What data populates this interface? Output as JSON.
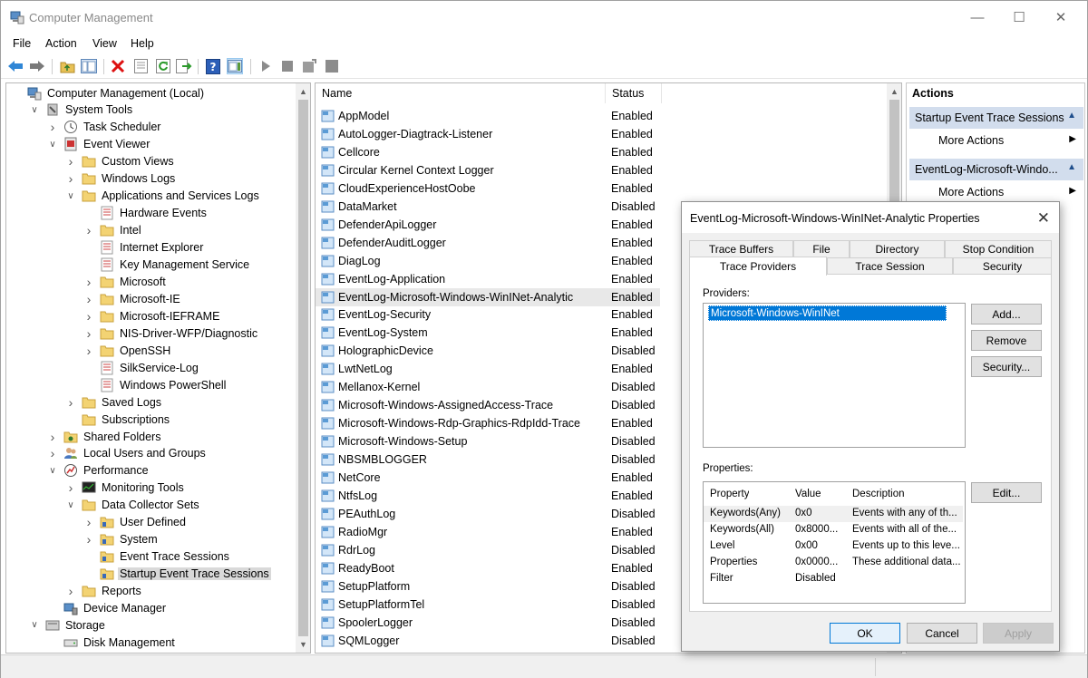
{
  "window": {
    "title": "Computer Management"
  },
  "menu": [
    "File",
    "Action",
    "View",
    "Help"
  ],
  "tree": [
    {
      "label": "Computer Management (Local)",
      "level": 0,
      "exp": "",
      "icon": "computer-management-icon"
    },
    {
      "label": "System Tools",
      "level": 1,
      "exp": "open",
      "icon": "system-tools-icon"
    },
    {
      "label": "Task Scheduler",
      "level": 2,
      "exp": "closed",
      "icon": "task-scheduler-icon"
    },
    {
      "label": "Event Viewer",
      "level": 2,
      "exp": "open",
      "icon": "event-viewer-icon"
    },
    {
      "label": "Custom Views",
      "level": 3,
      "exp": "closed",
      "icon": "folder-icon"
    },
    {
      "label": "Windows Logs",
      "level": 3,
      "exp": "closed",
      "icon": "folder-icon"
    },
    {
      "label": "Applications and Services Logs",
      "level": 3,
      "exp": "open",
      "icon": "folder-icon"
    },
    {
      "label": "Hardware Events",
      "level": 4,
      "exp": "",
      "icon": "log-icon"
    },
    {
      "label": "Intel",
      "level": 4,
      "exp": "closed",
      "icon": "folder-icon"
    },
    {
      "label": "Internet Explorer",
      "level": 4,
      "exp": "",
      "icon": "log-icon"
    },
    {
      "label": "Key Management Service",
      "level": 4,
      "exp": "",
      "icon": "log-icon"
    },
    {
      "label": "Microsoft",
      "level": 4,
      "exp": "closed",
      "icon": "folder-icon"
    },
    {
      "label": "Microsoft-IE",
      "level": 4,
      "exp": "closed",
      "icon": "folder-icon"
    },
    {
      "label": "Microsoft-IEFRAME",
      "level": 4,
      "exp": "closed",
      "icon": "folder-icon"
    },
    {
      "label": "NIS-Driver-WFP/Diagnostic",
      "level": 4,
      "exp": "closed",
      "icon": "folder-icon"
    },
    {
      "label": "OpenSSH",
      "level": 4,
      "exp": "closed",
      "icon": "folder-icon"
    },
    {
      "label": "SilkService-Log",
      "level": 4,
      "exp": "",
      "icon": "log-icon"
    },
    {
      "label": "Windows PowerShell",
      "level": 4,
      "exp": "",
      "icon": "log-icon"
    },
    {
      "label": "Saved Logs",
      "level": 3,
      "exp": "closed",
      "icon": "folder-icon"
    },
    {
      "label": "Subscriptions",
      "level": 3,
      "exp": "",
      "icon": "folder-icon"
    },
    {
      "label": "Shared Folders",
      "level": 2,
      "exp": "closed",
      "icon": "shared-folders-icon"
    },
    {
      "label": "Local Users and Groups",
      "level": 2,
      "exp": "closed",
      "icon": "users-icon"
    },
    {
      "label": "Performance",
      "level": 2,
      "exp": "open",
      "icon": "performance-icon"
    },
    {
      "label": "Monitoring Tools",
      "level": 3,
      "exp": "closed",
      "icon": "monitoring-icon"
    },
    {
      "label": "Data Collector Sets",
      "level": 3,
      "exp": "open",
      "icon": "folder-icon"
    },
    {
      "label": "User Defined",
      "level": 4,
      "exp": "closed",
      "icon": "collector-icon"
    },
    {
      "label": "System",
      "level": 4,
      "exp": "closed",
      "icon": "collector-icon"
    },
    {
      "label": "Event Trace Sessions",
      "level": 4,
      "exp": "",
      "icon": "collector-icon"
    },
    {
      "label": "Startup Event Trace Sessions",
      "level": 4,
      "exp": "",
      "icon": "collector-icon",
      "selected": true
    },
    {
      "label": "Reports",
      "level": 3,
      "exp": "closed",
      "icon": "folder-icon"
    },
    {
      "label": "Device Manager",
      "level": 2,
      "exp": "",
      "icon": "device-manager-icon"
    },
    {
      "label": "Storage",
      "level": 1,
      "exp": "open",
      "icon": "storage-icon"
    },
    {
      "label": "Disk Management",
      "level": 2,
      "exp": "",
      "icon": "disk-icon"
    }
  ],
  "list": {
    "headers": {
      "name": "Name",
      "status": "Status"
    },
    "rows": [
      {
        "name": "AppModel",
        "status": "Enabled"
      },
      {
        "name": "AutoLogger-Diagtrack-Listener",
        "status": "Enabled"
      },
      {
        "name": "Cellcore",
        "status": "Enabled"
      },
      {
        "name": "Circular Kernel Context Logger",
        "status": "Enabled"
      },
      {
        "name": "CloudExperienceHostOobe",
        "status": "Enabled"
      },
      {
        "name": "DataMarket",
        "status": "Disabled"
      },
      {
        "name": "DefenderApiLogger",
        "status": "Enabled"
      },
      {
        "name": "DefenderAuditLogger",
        "status": "Enabled"
      },
      {
        "name": "DiagLog",
        "status": "Enabled"
      },
      {
        "name": "EventLog-Application",
        "status": "Enabled"
      },
      {
        "name": "EventLog-Microsoft-Windows-WinINet-Analytic",
        "status": "Enabled",
        "highlight": true
      },
      {
        "name": "EventLog-Security",
        "status": "Enabled"
      },
      {
        "name": "EventLog-System",
        "status": "Enabled"
      },
      {
        "name": "HolographicDevice",
        "status": "Disabled"
      },
      {
        "name": "LwtNetLog",
        "status": "Enabled"
      },
      {
        "name": "Mellanox-Kernel",
        "status": "Disabled"
      },
      {
        "name": "Microsoft-Windows-AssignedAccess-Trace",
        "status": "Disabled"
      },
      {
        "name": "Microsoft-Windows-Rdp-Graphics-RdpIdd-Trace",
        "status": "Enabled"
      },
      {
        "name": "Microsoft-Windows-Setup",
        "status": "Disabled"
      },
      {
        "name": "NBSMBLOGGER",
        "status": "Disabled"
      },
      {
        "name": "NetCore",
        "status": "Enabled"
      },
      {
        "name": "NtfsLog",
        "status": "Enabled"
      },
      {
        "name": "PEAuthLog",
        "status": "Disabled"
      },
      {
        "name": "RadioMgr",
        "status": "Enabled"
      },
      {
        "name": "RdrLog",
        "status": "Disabled"
      },
      {
        "name": "ReadyBoot",
        "status": "Enabled"
      },
      {
        "name": "SetupPlatform",
        "status": "Disabled"
      },
      {
        "name": "SetupPlatformTel",
        "status": "Disabled"
      },
      {
        "name": "SpoolerLogger",
        "status": "Disabled"
      },
      {
        "name": "SQMLogger",
        "status": "Disabled"
      }
    ]
  },
  "actions": {
    "title": "Actions",
    "section1": "Startup Event Trace Sessions",
    "section1_item": "More Actions",
    "section2": "EventLog-Microsoft-Windo...",
    "section2_item": "More Actions"
  },
  "dialog": {
    "title": "EventLog-Microsoft-Windows-WinINet-Analytic Properties",
    "tabs_row1": [
      "Trace Buffers",
      "File",
      "Directory",
      "Stop Condition"
    ],
    "tabs_row2": [
      "Trace Providers",
      "Trace Session",
      "Security"
    ],
    "providers_label": "Providers:",
    "providers": [
      "Microsoft-Windows-WinINet"
    ],
    "add_btn": "Add...",
    "remove_btn": "Remove",
    "security_btn": "Security...",
    "properties_label": "Properties:",
    "prop_headers": {
      "property": "Property",
      "value": "Value",
      "description": "Description"
    },
    "props": [
      {
        "property": "Keywords(Any)",
        "value": "0x0",
        "description": "Events with any of th..."
      },
      {
        "property": "Keywords(All)",
        "value": "0x8000...",
        "description": "Events with all of the..."
      },
      {
        "property": "Level",
        "value": "0x00",
        "description": "Events up to this leve..."
      },
      {
        "property": "Properties",
        "value": "0x0000...",
        "description": "These additional data..."
      },
      {
        "property": "Filter",
        "value": "Disabled",
        "description": ""
      }
    ],
    "edit_btn": "Edit...",
    "ok_btn": "OK",
    "cancel_btn": "Cancel",
    "apply_btn": "Apply"
  }
}
